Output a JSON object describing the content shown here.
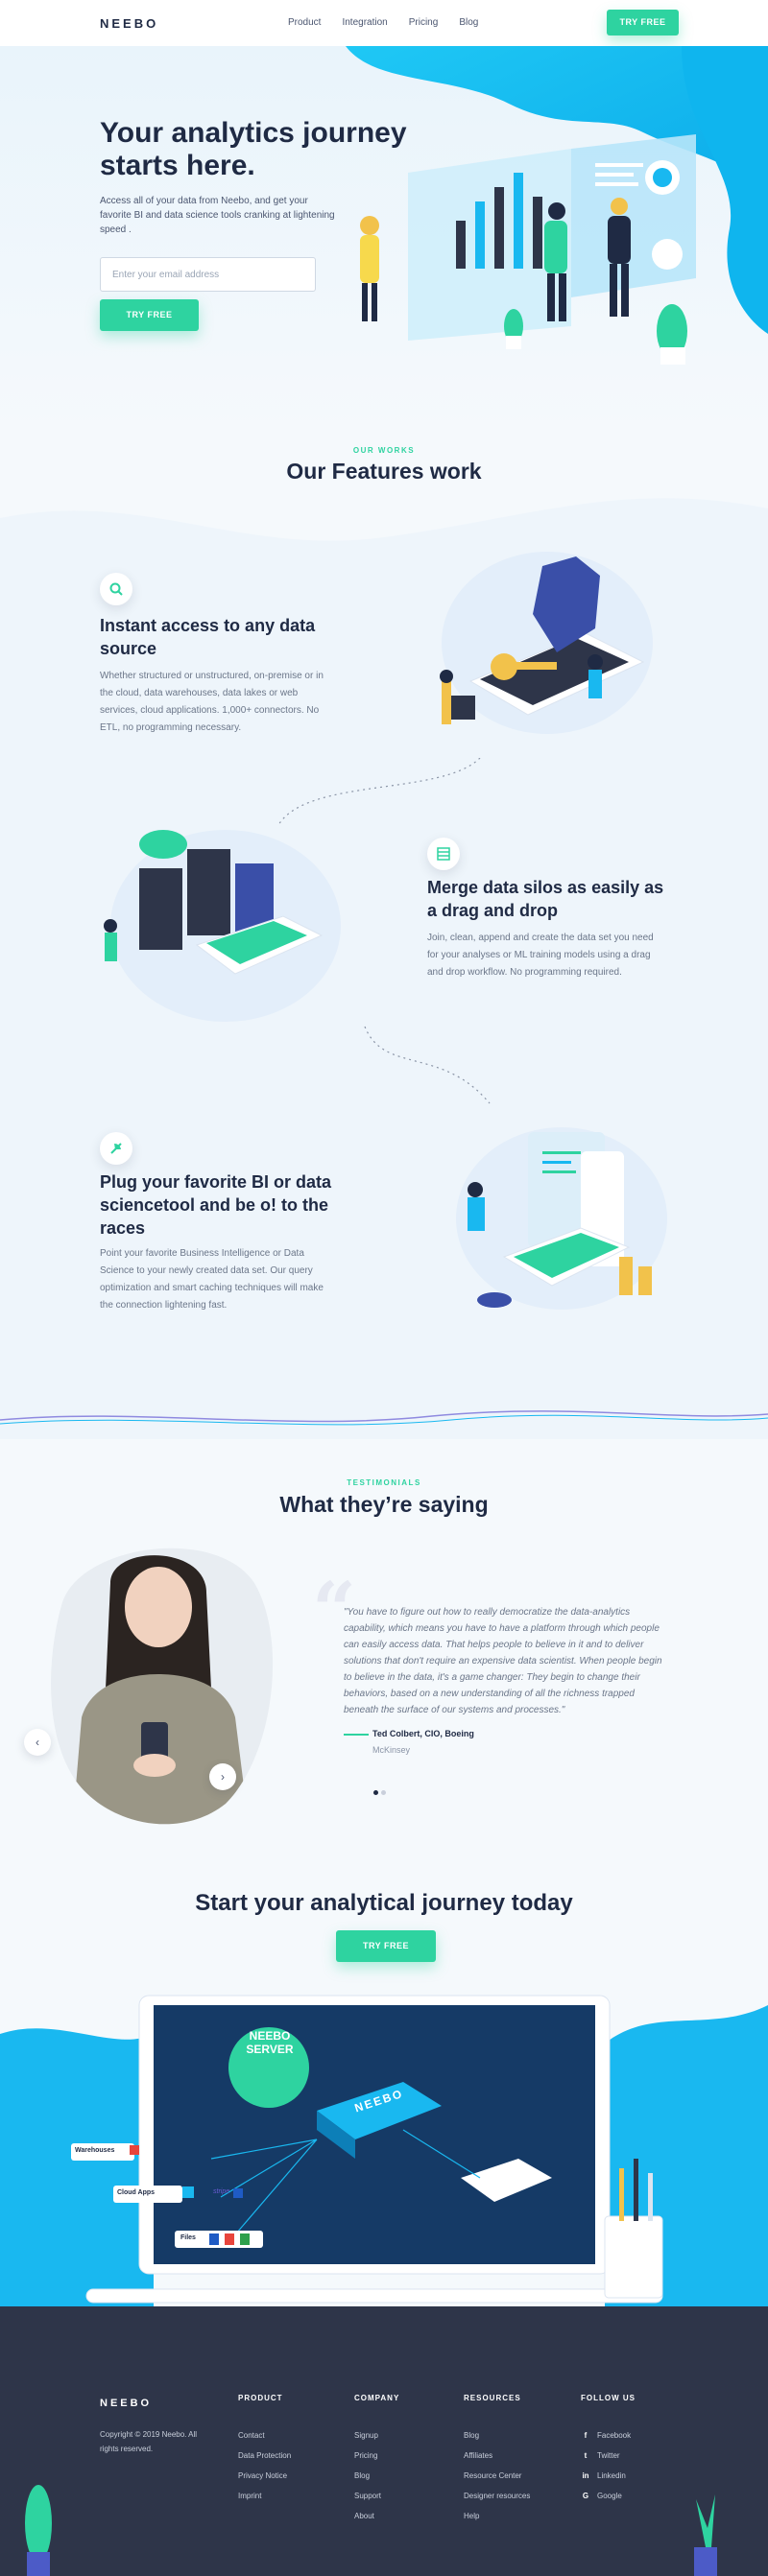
{
  "header": {
    "logo": "NEEBO",
    "nav": [
      "Product",
      "Integration",
      "Pricing",
      "Blog"
    ],
    "cta": "TRY FREE"
  },
  "hero": {
    "title": "Your analytics journey starts here.",
    "description": "Access all of your data from Neebo, and get your favorite BI and data science tools cranking at lightening speed .",
    "email_placeholder": "Enter your email address",
    "cta": "TRY FREE"
  },
  "features": {
    "eyebrow": "OUR WORKS",
    "title": "Our Features work",
    "items": [
      {
        "title": "Instant access to any data source",
        "description": "Whether structured or unstructured, on-premise or in the cloud, data warehouses, data lakes or web services, cloud applications. 1,000+ connectors. No ETL, no programming necessary."
      },
      {
        "title": "Merge data silos as easily as a drag and drop",
        "description": "Join, clean, append and create the data set you need for your analyses or ML training models using a drag and drop workflow. No programming required."
      },
      {
        "title": "Plug your favorite BI or data sciencetool and be o! to the races",
        "description": "Point your favorite Business Intelligence or Data Science to your newly created data set. Our query optimization and smart caching techniques will make the connection lightening fast."
      }
    ]
  },
  "testimonials": {
    "eyebrow": "TESTIMONIALS",
    "title": "What they’re saying",
    "quote": "\"You have to figure out how to really democratize the data-analytics capability, which means you have to have a platform through which people can easily access data. That helps people to believe in it and to deliver solutions that don't require an expensive data scientist. When people begin to believe in the data, it's a game changer: They begin to change their behaviors, based on a new understanding of all the richness trapped beneath the surface of our systems and processes.\"",
    "author": "Ted Colbert, CIO, Boeing",
    "company": "McKinsey",
    "prev": "‹",
    "next": "›"
  },
  "cta_section": {
    "title": "Start your analytical journey today",
    "cta": "TRY FREE",
    "illustration": {
      "server_badge_line1": "NEEBO",
      "server_badge_line2": "SERVER",
      "server_label": "NEEBO",
      "sources": [
        "Warehouses",
        "Cloud Apps",
        "Files"
      ],
      "stripe": "stripe"
    }
  },
  "footer": {
    "logo": "NEEBO",
    "copyright": "Copyright © 2019 Neebo. All rights reserved.",
    "columns": [
      {
        "title": "PRODUCT",
        "links": [
          "Contact",
          "Data Protection",
          "Privacy Notice",
          "Imprint"
        ]
      },
      {
        "title": "COMPANY",
        "links": [
          "Signup",
          "Pricing",
          "Blog",
          "Support",
          "About"
        ]
      },
      {
        "title": "RESOURCES",
        "links": [
          "Blog",
          "Affiliates",
          "Resource Center",
          "Designer resources",
          "Help"
        ]
      }
    ],
    "follow": {
      "title": "FOLLOW US",
      "links": [
        {
          "icon": "facebook-icon",
          "label": "Facebook"
        },
        {
          "icon": "twitter-icon",
          "label": "Twitter"
        },
        {
          "icon": "linkedin-icon",
          "label": "Linkedin"
        },
        {
          "icon": "google-icon",
          "label": "Google"
        }
      ]
    }
  },
  "colors": {
    "accent": "#2ed3a0",
    "blue": "#19b8f0",
    "navy": "#1f2a44",
    "footer": "#2e3549"
  }
}
